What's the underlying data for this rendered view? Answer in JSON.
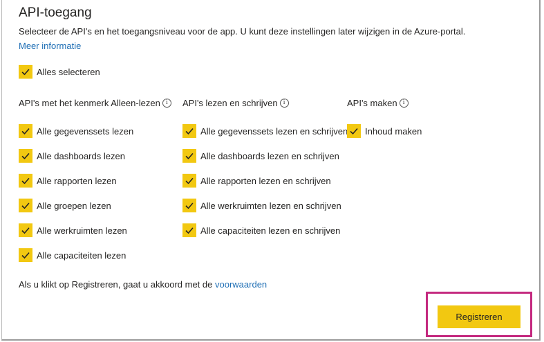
{
  "title": "API-toegang",
  "description": "Selecteer de API's en het toegangsniveau voor de app. U kunt deze instellingen later wijzigen in de Azure-portal.",
  "learn_more": "Meer informatie",
  "select_all": {
    "label": "Alles selecteren",
    "checked": true
  },
  "columns": [
    {
      "header": "API's met het kenmerk Alleen-lezen",
      "items": [
        {
          "label": "Alle gegevenssets lezen",
          "checked": true
        },
        {
          "label": "Alle dashboards lezen",
          "checked": true
        },
        {
          "label": "Alle rapporten lezen",
          "checked": true
        },
        {
          "label": "Alle groepen lezen",
          "checked": true
        },
        {
          "label": "Alle werkruimten lezen",
          "checked": true
        },
        {
          "label": "Alle capaciteiten lezen",
          "checked": true
        }
      ]
    },
    {
      "header": "API's lezen en schrijven",
      "items": [
        {
          "label": "Alle gegevenssets lezen en schrijven",
          "checked": true
        },
        {
          "label": "Alle dashboards lezen en schrijven",
          "checked": true
        },
        {
          "label": "Alle rapporten lezen en schrijven",
          "checked": true
        },
        {
          "label": "Alle werkruimten lezen en schrijven",
          "checked": true
        },
        {
          "label": "Alle capaciteiten lezen en schrijven",
          "checked": true
        }
      ]
    },
    {
      "header": "API's maken",
      "items": [
        {
          "label": "Inhoud maken",
          "checked": true
        }
      ]
    }
  ],
  "info_glyph": "i",
  "terms_text": "Als u klikt op Registreren, gaat u akkoord met de",
  "terms_link": "voorwaarden",
  "register_button": "Registreren",
  "colors": {
    "accent": "#f2c811",
    "link": "#1f6fb5",
    "highlight": "#c4297f"
  }
}
